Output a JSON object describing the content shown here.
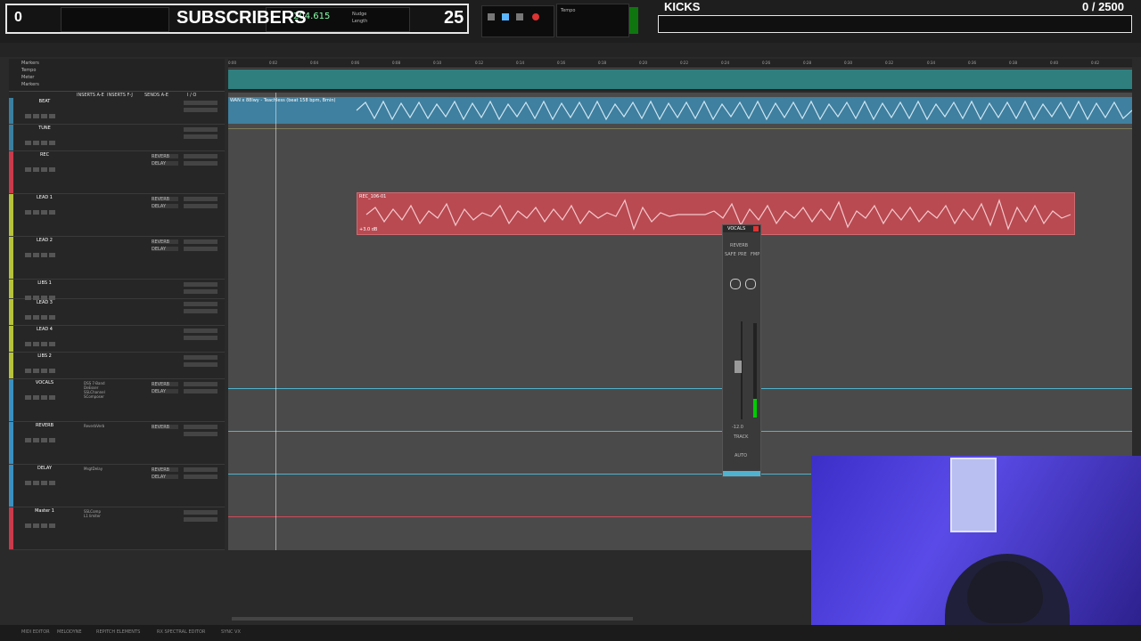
{
  "overlay": {
    "subscribers_label": "SUBSCRIBERS",
    "subscribers_left": "0",
    "subscribers_right": "25",
    "kicks_label": "KICKS",
    "kicks_score": "0 / 2500"
  },
  "transport": {
    "counter": "204.615",
    "tempo_label": "Tempo",
    "nudge_label": "Nudge",
    "length_label": "Length"
  },
  "tracklist": {
    "header_cols": [
      "INSERTS A-E",
      "INSERTS F-J",
      "SENDS A-E",
      "I / O"
    ],
    "tracks": [
      {
        "name": "BEAT",
        "inserts": [],
        "sends": [],
        "color": "#3a7fa0",
        "height": 30
      },
      {
        "name": "TUNE",
        "inserts": [],
        "sends": [],
        "color": "#3a7fa0",
        "height": 30
      },
      {
        "name": "REC",
        "inserts": [],
        "sends": [
          "REVERB",
          "DELAY"
        ],
        "color": "#c93a4a",
        "height": 48
      },
      {
        "name": "LEAD 1",
        "inserts": [],
        "sends": [
          "REVERB",
          "DELAY"
        ],
        "color": "#b6c23a",
        "height": 48
      },
      {
        "name": "LEAD 2",
        "inserts": [],
        "sends": [
          "REVERB",
          "DELAY"
        ],
        "color": "#b6c23a",
        "height": 48
      },
      {
        "name": "LIBS 1",
        "inserts": [],
        "sends": [],
        "color": "#b6c23a",
        "height": 22
      },
      {
        "name": "LEAD 3",
        "inserts": [],
        "sends": [],
        "color": "#b6c23a",
        "height": 30
      },
      {
        "name": "LEAD 4",
        "inserts": [],
        "sends": [],
        "color": "#b6c23a",
        "height": 30
      },
      {
        "name": "LIBS 2",
        "inserts": [],
        "sends": [],
        "color": "#b6c23a",
        "height": 30
      },
      {
        "name": "VOCALS",
        "inserts": [
          "DSS 7-Band",
          "DeEsser",
          "SSLChannel",
          "SComposer"
        ],
        "sends": [
          "REVERB",
          "DELAY"
        ],
        "color": "#3a8fc0",
        "height": 48
      },
      {
        "name": "REVERB",
        "inserts": [
          "ReverbVerb"
        ],
        "sends": [
          "REVERB"
        ],
        "color": "#3a8fc0",
        "height": 48
      },
      {
        "name": "DELAY",
        "inserts": [
          "MsgtDelay"
        ],
        "sends": [
          "REVERB",
          "DELAY"
        ],
        "color": "#3a8fc0",
        "height": 48
      },
      {
        "name": "Master 1",
        "inserts": [
          "SSLComp",
          "L1 limiter"
        ],
        "sends": [],
        "color": "#c93a4a",
        "height": 48
      }
    ]
  },
  "ruler": {
    "labels": [
      "0:00",
      "0:02",
      "0:04",
      "0:06",
      "0:08",
      "0:10",
      "0:12",
      "0:14",
      "0:16",
      "0:18",
      "0:20",
      "0:22",
      "0:24",
      "0:26",
      "0:28",
      "0:30",
      "0:32",
      "0:34",
      "0:36",
      "0:38",
      "0:40",
      "0:42"
    ],
    "rows": [
      "Markers",
      "Tempo",
      "Meter",
      "Markers"
    ]
  },
  "clips": {
    "beat": "WAN x 88lwy - Teachless (beat 158 bpm, Bmin)",
    "rec": "REC_106-01",
    "rec_gain": "+3.0 dB"
  },
  "strip": {
    "name": "VOCALS",
    "send": "REVERB",
    "buttons": [
      "SAFE",
      "PRE",
      "FMP"
    ],
    "fader_value": "-12.0",
    "track_label": "TRACK",
    "auto_label": "AUTO"
  },
  "webcam": {
    "count": "0"
  },
  "bottom": {
    "items": [
      "MIDI EDITOR",
      "MELODYNE",
      "REPITCH ELEMENTS",
      "RX SPECTRAL EDITOR",
      "SYNC VX"
    ]
  },
  "colors": {
    "beat_clip": "#3f7f9f",
    "rec_clip": "#b94a52",
    "tempo_lane": "#2f7f7f",
    "webcam_bg": "#4a3de0"
  }
}
